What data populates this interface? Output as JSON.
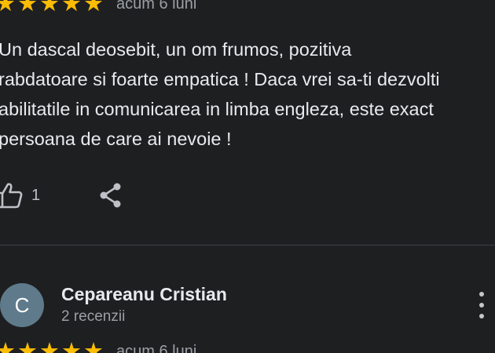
{
  "review1": {
    "rating": 5,
    "time": "acum 6 luni",
    "text": "Un dascal deosebit, un om frumos, pozitiva\nrabdatoare si foarte empatica ! Daca vrei sa-ti dezvolti\nabilitatile in comunicarea in limba engleza, este exact\npersoana de care ai nevoie !",
    "like_count": "1"
  },
  "review2": {
    "avatar_letter": "C",
    "author": "Cepareanu Cristian",
    "reviews_count": "2 recenzii",
    "rating": 5,
    "time": "acum 6 luni"
  },
  "icons": {
    "star": "star-icon",
    "like": "thumbs-up-icon",
    "share": "share-icon",
    "more": "more-vert-icon"
  },
  "colors": {
    "background": "#1e1f21",
    "star": "#fbbc04",
    "avatar": "#5f7a8a"
  }
}
